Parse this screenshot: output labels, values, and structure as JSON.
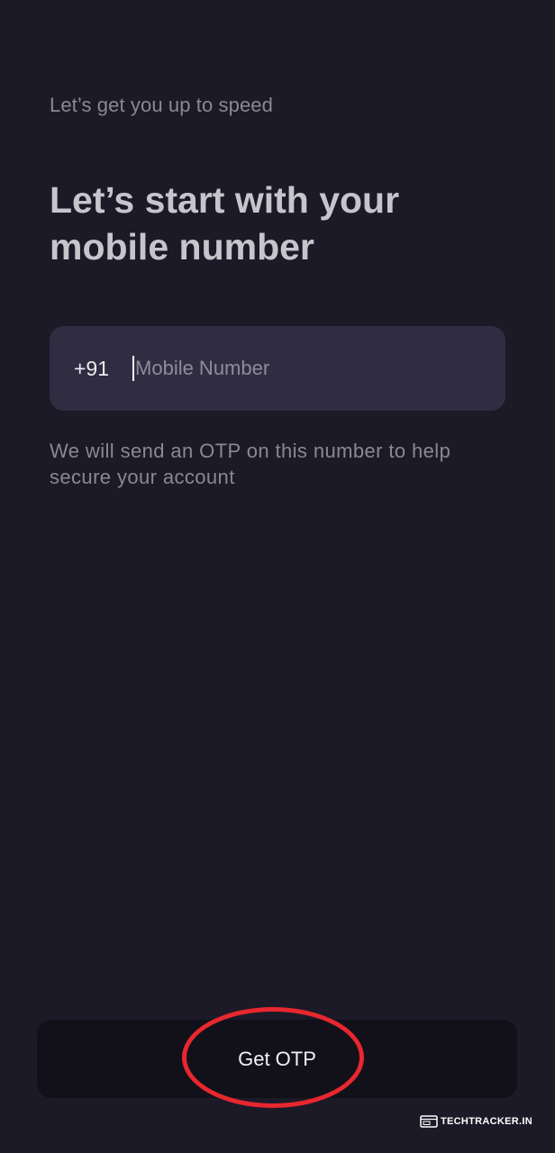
{
  "screen": {
    "eyebrow": "Let’s get you up to speed",
    "headline": "Let’s start with your mobile number",
    "phone_field": {
      "country_code": "+91",
      "placeholder": "Mobile Number",
      "value": ""
    },
    "helper_text": "We will send an OTP on this number to help secure your account",
    "primary_button_label": "Get OTP"
  },
  "watermark": {
    "text": "TECHTRACKER.IN"
  },
  "colors": {
    "background": "#1c1a27",
    "input_background": "#302d42",
    "button_background": "#121119",
    "annotation": "#e8272f"
  },
  "icons": {
    "watermark": "browser-window-icon"
  }
}
